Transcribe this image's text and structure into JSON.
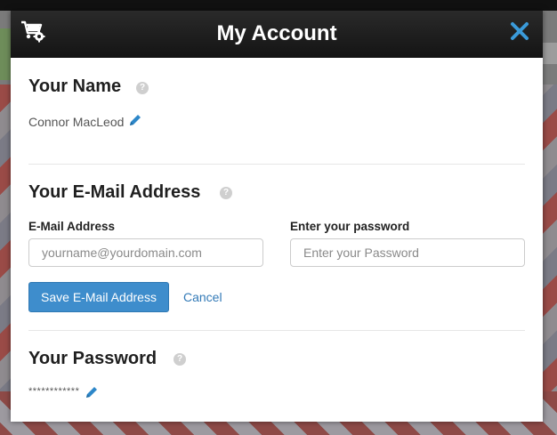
{
  "modal": {
    "title": "My Account",
    "close_icon": "close-icon",
    "cart_icon": "shopping-cart-settings-icon"
  },
  "name_section": {
    "title": "Your Name",
    "value": "Connor MacLeod",
    "help_icon": "?"
  },
  "email_section": {
    "title": "Your E-Mail Address",
    "help_icon": "?",
    "email_label": "E-Mail Address",
    "email_placeholder": "yourname@yourdomain.com",
    "password_label": "Enter your password",
    "password_placeholder": "Enter your Password",
    "save_label": "Save E-Mail Address",
    "cancel_label": "Cancel"
  },
  "password_section": {
    "title": "Your Password",
    "help_icon": "?",
    "value": "************"
  },
  "colors": {
    "accent": "#3e8dcc",
    "link": "#337ab7",
    "header": "#1b1b1b"
  }
}
